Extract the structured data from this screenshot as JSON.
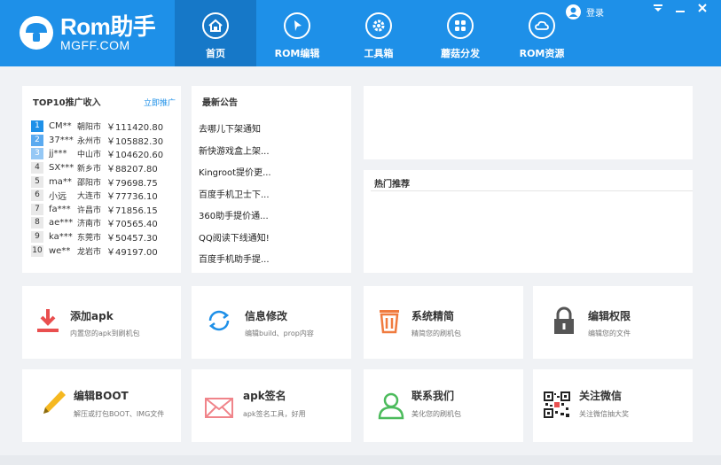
{
  "logo": {
    "brand": "Rom助手",
    "domain": "MGFF.COM"
  },
  "nav": [
    {
      "label": "首页",
      "icon": "home-icon",
      "active": true
    },
    {
      "label": "ROM编辑",
      "icon": "cursor-icon",
      "active": false
    },
    {
      "label": "工具箱",
      "icon": "gear-icon",
      "active": false
    },
    {
      "label": "蘑菇分发",
      "icon": "apps-grid-icon",
      "active": false
    },
    {
      "label": "ROM资源",
      "icon": "cloud-icon",
      "active": false
    }
  ],
  "header": {
    "login_label": "登录"
  },
  "top10": {
    "title": "TOP10推广收入",
    "link": "立即推广",
    "rows": [
      {
        "rank": "1",
        "user": "CM**",
        "city": "朝阳市",
        "amount": "￥111420.80"
      },
      {
        "rank": "2",
        "user": "37***",
        "city": "永州市",
        "amount": "￥105882.30"
      },
      {
        "rank": "3",
        "user": "jj***",
        "city": "中山市",
        "amount": "￥104620.60"
      },
      {
        "rank": "4",
        "user": "SX***",
        "city": "新乡市",
        "amount": "￥88207.80"
      },
      {
        "rank": "5",
        "user": "ma**",
        "city": "邵阳市",
        "amount": "￥79698.75"
      },
      {
        "rank": "6",
        "user": "小远",
        "city": "大连市",
        "amount": "￥77736.10"
      },
      {
        "rank": "7",
        "user": "fa***",
        "city": "许昌市",
        "amount": "￥71856.15"
      },
      {
        "rank": "8",
        "user": "ae***",
        "city": "济南市",
        "amount": "￥70565.40"
      },
      {
        "rank": "9",
        "user": "ka***",
        "city": "东莞市",
        "amount": "￥50457.30"
      },
      {
        "rank": "10",
        "user": "we**",
        "city": "龙岩市",
        "amount": "￥49197.00"
      }
    ]
  },
  "notices": {
    "title": "最新公告",
    "items": [
      "去哪儿下架通知",
      "新快游戏盒上架...",
      "Kingroot提价更...",
      "百度手机卫士下...",
      "360助手提价通...",
      "QQ阅读下线通知!",
      "百度手机助手提..."
    ]
  },
  "hot": {
    "title": "热门推荐"
  },
  "cards": [
    {
      "title": "添加apk",
      "desc": "内置您的apk到刷机包",
      "icon": "download-arrow-icon"
    },
    {
      "title": "信息修改",
      "desc": "编辑build、prop内容",
      "icon": "refresh-icon"
    },
    {
      "title": "系统精简",
      "desc": "精简您的刷机包",
      "icon": "trash-icon"
    },
    {
      "title": "编辑权限",
      "desc": "编辑您的文件",
      "icon": "lock-icon"
    },
    {
      "title": "编辑BOOT",
      "desc": "解压或打包BOOT、IMG文件",
      "icon": "pencil-icon"
    },
    {
      "title": "apk签名",
      "desc": "apk签名工具，好用",
      "icon": "envelope-icon"
    },
    {
      "title": "联系我们",
      "desc": "美化您的刷机包",
      "icon": "user-icon"
    },
    {
      "title": "关注微信",
      "desc": "关注微信抽大奖",
      "icon": "qr-code-icon"
    }
  ],
  "colors": {
    "primary": "#1e90e8",
    "nav_active": "#1678c8",
    "background": "#f0f2f5"
  }
}
